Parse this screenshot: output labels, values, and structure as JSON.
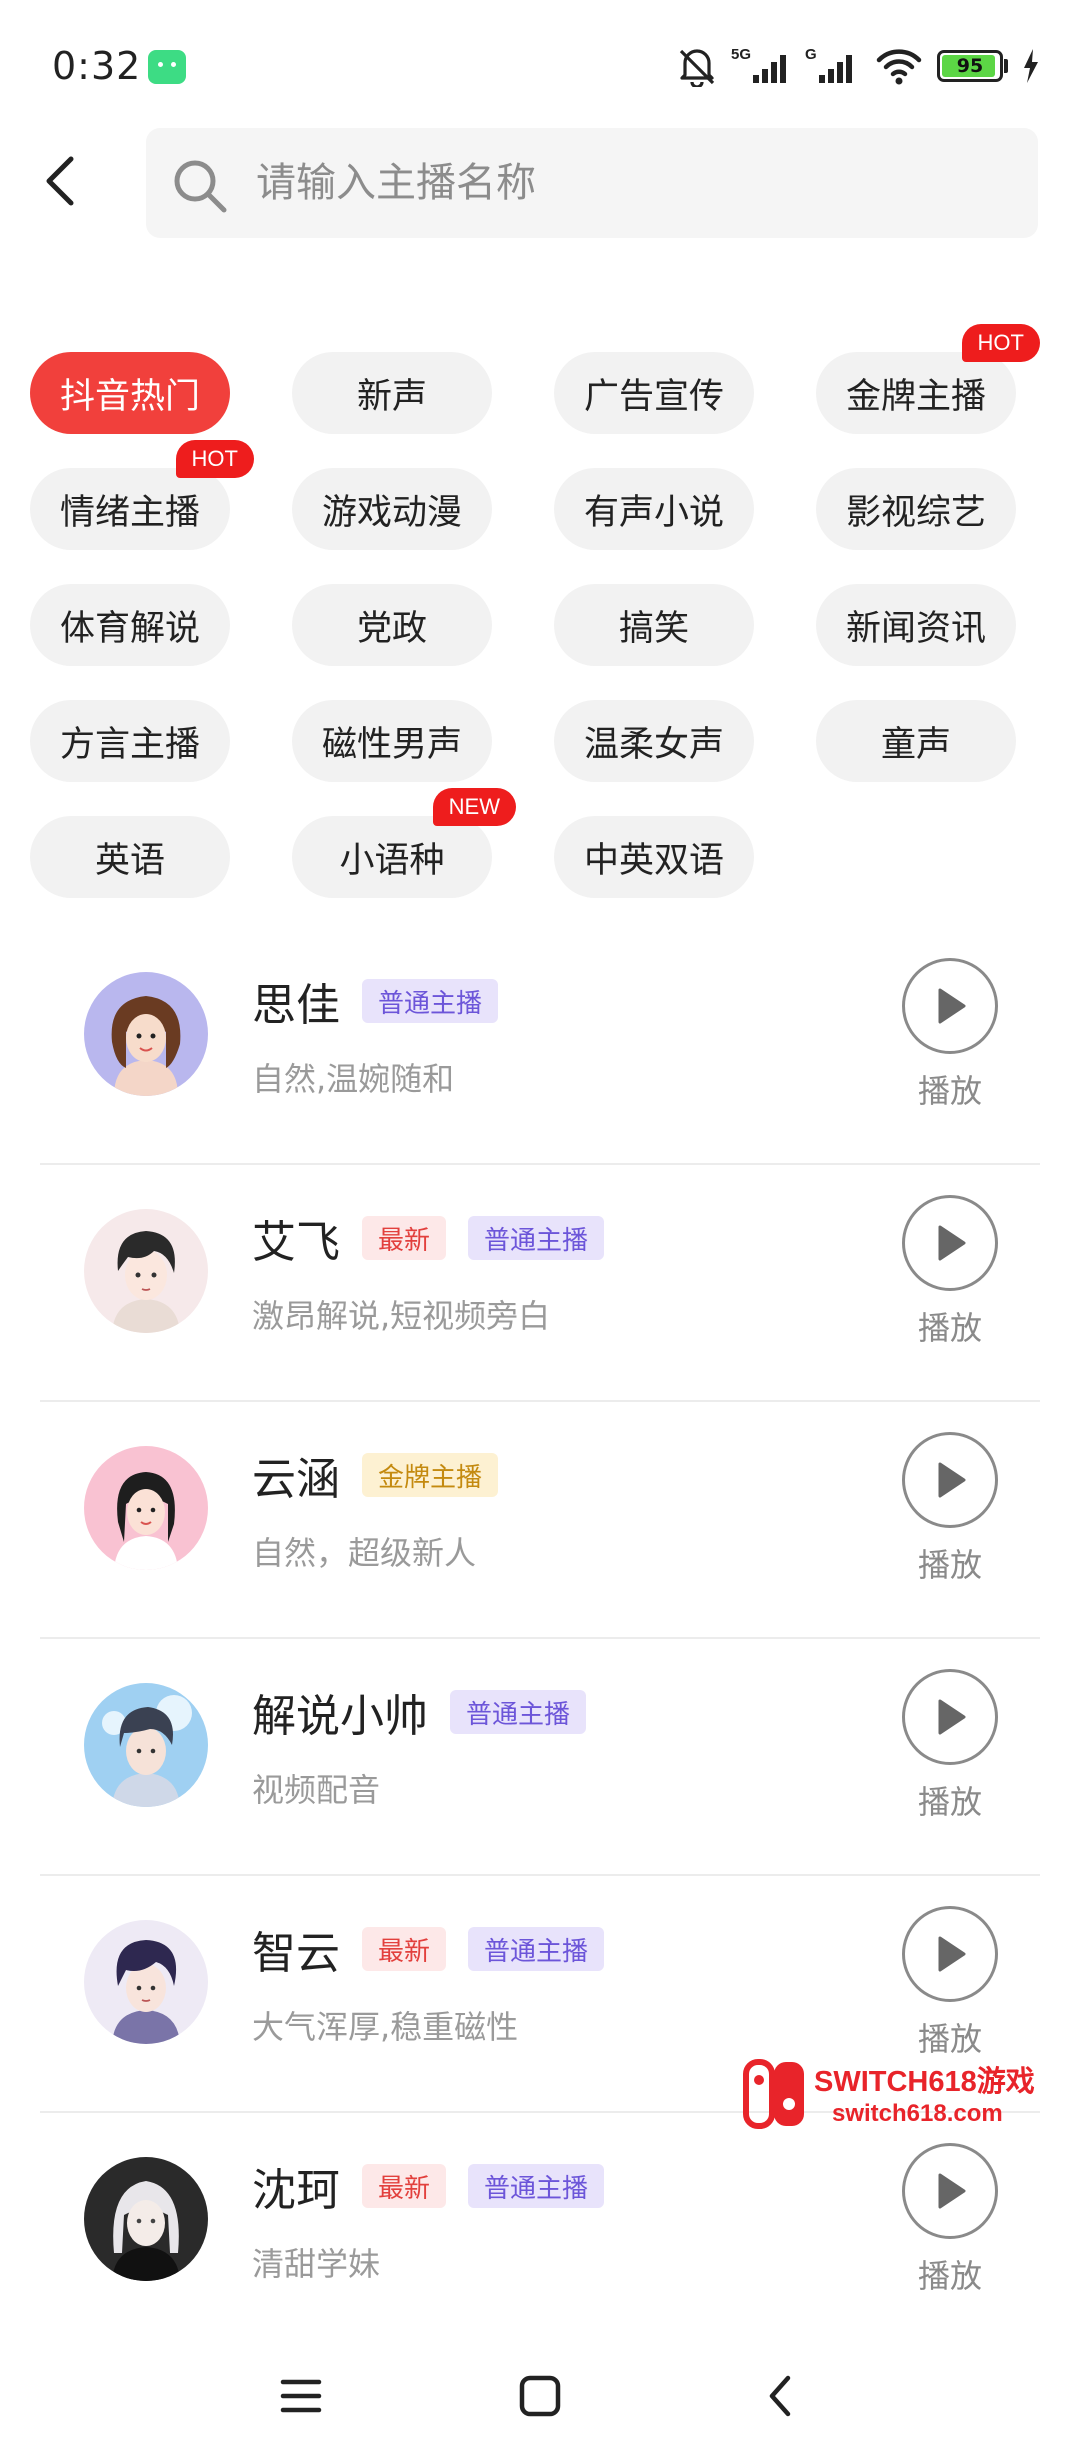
{
  "status_bar": {
    "time": "0:32",
    "network_1": "5G",
    "network_2": "G",
    "battery": "95",
    "battery_level": 0.95,
    "icons": [
      "android-app-icon",
      "mute-bell-icon",
      "signal-icon",
      "signal-icon",
      "wifi-icon",
      "battery-icon",
      "charging-icon"
    ]
  },
  "header": {
    "back_icon": "back-arrow-icon",
    "search_placeholder": "请输入主播名称",
    "search_value": ""
  },
  "categories": [
    {
      "label": "抖音热门",
      "active": true,
      "badge": ""
    },
    {
      "label": "新声",
      "active": false,
      "badge": ""
    },
    {
      "label": "广告宣传",
      "active": false,
      "badge": ""
    },
    {
      "label": "金牌主播",
      "active": false,
      "badge": "HOT"
    },
    {
      "label": "情绪主播",
      "active": false,
      "badge": "HOT"
    },
    {
      "label": "游戏动漫",
      "active": false,
      "badge": ""
    },
    {
      "label": "有声小说",
      "active": false,
      "badge": ""
    },
    {
      "label": "影视综艺",
      "active": false,
      "badge": ""
    },
    {
      "label": "体育解说",
      "active": false,
      "badge": ""
    },
    {
      "label": "党政",
      "active": false,
      "badge": ""
    },
    {
      "label": "搞笑",
      "active": false,
      "badge": ""
    },
    {
      "label": "新闻资讯",
      "active": false,
      "badge": ""
    },
    {
      "label": "方言主播",
      "active": false,
      "badge": ""
    },
    {
      "label": "磁性男声",
      "active": false,
      "badge": ""
    },
    {
      "label": "温柔女声",
      "active": false,
      "badge": ""
    },
    {
      "label": "童声",
      "active": false,
      "badge": ""
    },
    {
      "label": "英语",
      "active": false,
      "badge": ""
    },
    {
      "label": "小语种",
      "active": false,
      "badge": "NEW"
    },
    {
      "label": "中英双语",
      "active": false,
      "badge": ""
    }
  ],
  "anchors": [
    {
      "name": "思佳",
      "tags": [
        {
          "text": "普通主播",
          "style": "purple"
        }
      ],
      "desc": "自然,温婉随和",
      "play": "播放",
      "avatar": "woman-cartoon-avatar"
    },
    {
      "name": "艾飞",
      "tags": [
        {
          "text": "最新",
          "style": "red"
        },
        {
          "text": "普通主播",
          "style": "purple"
        }
      ],
      "desc": "激昂解说,短视频旁白",
      "play": "播放",
      "avatar": "man-anime-avatar"
    },
    {
      "name": "云涵",
      "tags": [
        {
          "text": "金牌主播",
          "style": "gold"
        }
      ],
      "desc": "自然，超级新人",
      "play": "播放",
      "avatar": "girl-pink-avatar"
    },
    {
      "name": "解说小帅",
      "tags": [
        {
          "text": "普通主播",
          "style": "purple"
        }
      ],
      "desc": "视频配音",
      "play": "播放",
      "avatar": "boy-sky-avatar"
    },
    {
      "name": "智云",
      "tags": [
        {
          "text": "最新",
          "style": "red"
        },
        {
          "text": "普通主播",
          "style": "purple"
        }
      ],
      "desc": "大气浑厚,稳重磁性",
      "play": "播放",
      "avatar": "man-purple-anime-avatar"
    },
    {
      "name": "沈珂",
      "tags": [
        {
          "text": "最新",
          "style": "red"
        },
        {
          "text": "普通主播",
          "style": "purple"
        }
      ],
      "desc": "清甜学妹",
      "play": "播放",
      "avatar": "girl-dark-anime-avatar"
    }
  ],
  "watermark": {
    "title": "SWITCH618游戏",
    "subtitle": "switch618.com",
    "logo": "switch-logo-icon"
  },
  "nav_bar": {
    "buttons": [
      "menu-icon",
      "home-square-icon",
      "back-chevron-icon"
    ]
  },
  "colors": {
    "accent_red": "#f1403c",
    "badge_red": "#ee1d1d",
    "tag_purple": "#6c55d9",
    "tag_red": "#e2403d",
    "tag_gold": "#c48a0f",
    "battery_green": "#5cd645"
  }
}
